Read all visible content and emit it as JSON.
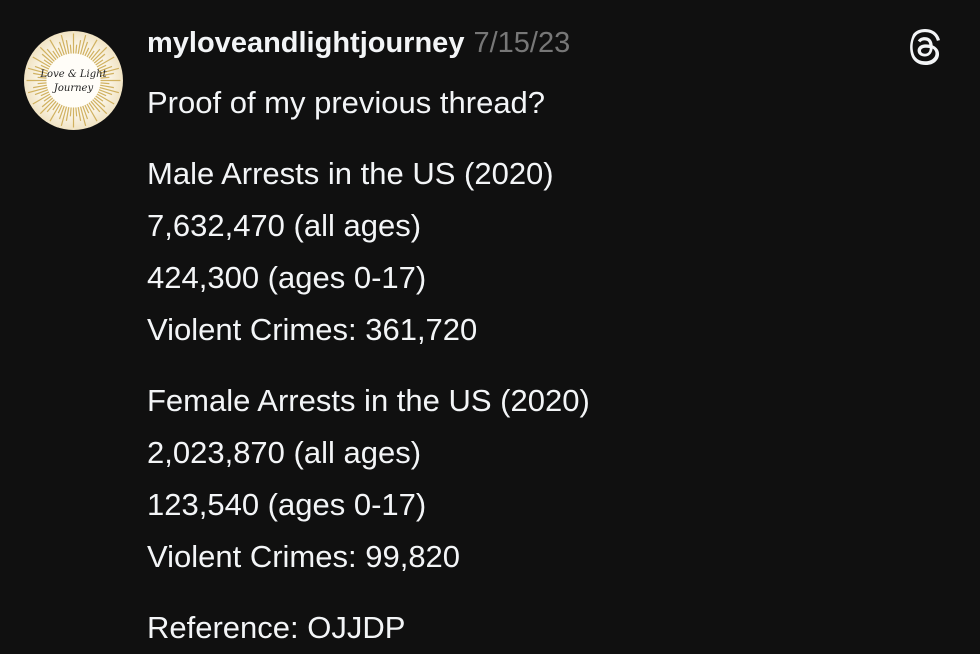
{
  "post": {
    "avatar_text": [
      "Love & Light",
      "Journey"
    ],
    "username": "myloveandlightjourney",
    "timestamp": "7/15/23",
    "lines": {
      "intro": "Proof of my previous thread?",
      "male_title": "Male Arrests in the US (2020)",
      "male_all": "7,632,470 (all ages)",
      "male_juvenile": "424,300 (ages 0-17)",
      "male_violent": "Violent Crimes: 361,720",
      "female_title": "Female Arrests in the US (2020)",
      "female_all": "2,023,870 (all ages)",
      "female_juvenile": "123,540 (ages 0-17)",
      "female_violent": "Violent Crimes: 99,820",
      "reference": "Reference: OJJDP"
    }
  },
  "icons": {
    "threads": "threads-logo-icon"
  },
  "colors": {
    "background": "#101010",
    "text": "#f3f5f7",
    "muted": "#777777",
    "avatar_gold": "#c9a64a"
  }
}
